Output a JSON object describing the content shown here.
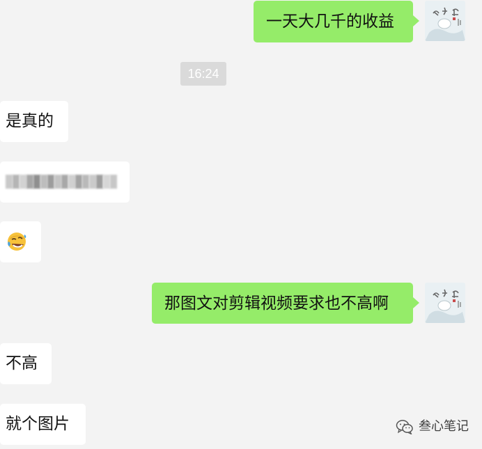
{
  "chat": {
    "timestamp": "16:24",
    "messages": [
      {
        "side": "out",
        "text": "一天大几千的收益"
      },
      {
        "side": "in",
        "text": "是真的"
      },
      {
        "side": "in",
        "text": "",
        "blurred": true
      },
      {
        "side": "in",
        "text": "",
        "emoji": "rolling-on-floor-laughing-emoji"
      },
      {
        "side": "out",
        "text": "那图文对剪辑视频要求也不高啊"
      },
      {
        "side": "in",
        "text": "不高"
      },
      {
        "side": "in",
        "text": "就个图片"
      }
    ]
  },
  "watermark": {
    "icon": "wechat-icon",
    "text": "叁心笔记"
  },
  "colors": {
    "background": "#f3f3f3",
    "outgoing_bubble": "#95ec69",
    "incoming_bubble": "#ffffff",
    "timestamp_bg": "#dadada"
  }
}
